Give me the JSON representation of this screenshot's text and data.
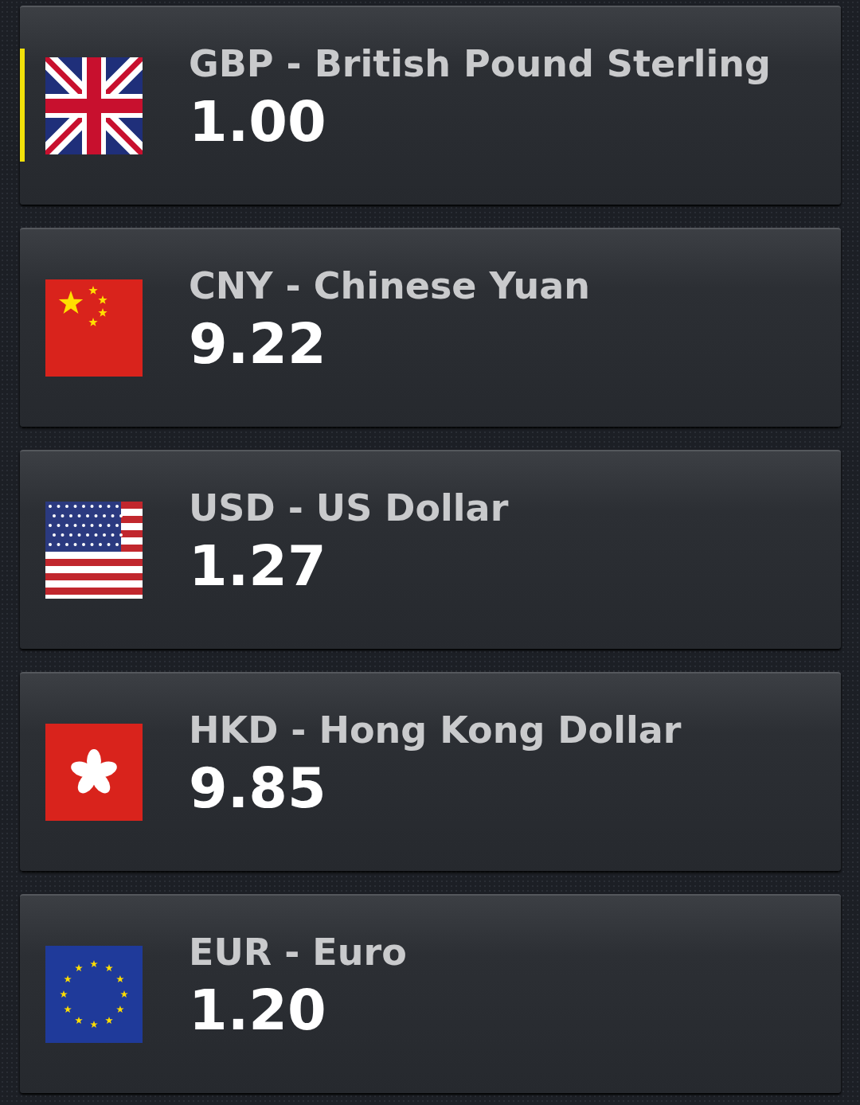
{
  "currencies": [
    {
      "kind": "uk",
      "label": "GBP - British Pound Sterling",
      "value": "1.00",
      "selected": true
    },
    {
      "kind": "cn",
      "label": "CNY - Chinese Yuan",
      "value": "9.22",
      "selected": false
    },
    {
      "kind": "us",
      "label": "USD - US Dollar",
      "value": "1.27",
      "selected": false
    },
    {
      "kind": "hk",
      "label": "HKD - Hong Kong Dollar",
      "value": "9.85",
      "selected": false
    },
    {
      "kind": "eu",
      "label": "EUR - Euro",
      "value": "1.20",
      "selected": false
    }
  ]
}
